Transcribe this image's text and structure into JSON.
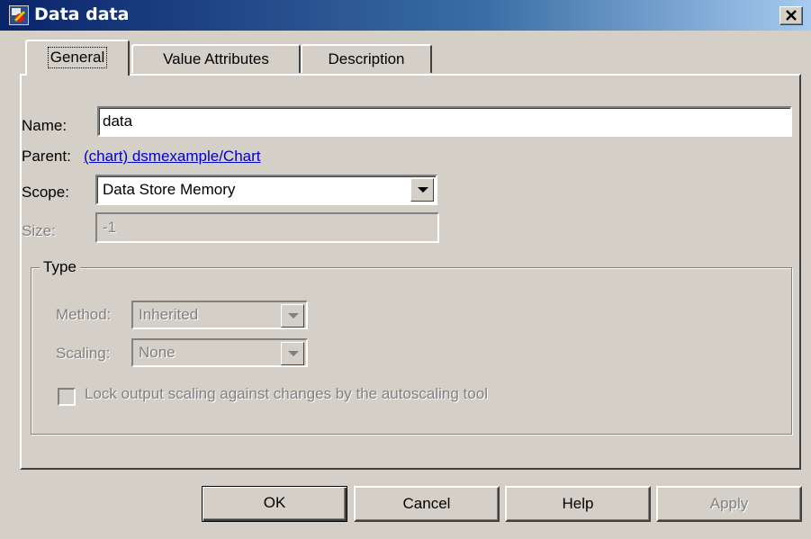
{
  "window": {
    "title": "Data data",
    "app_icon": "stateflow-app-icon",
    "close_icon": "close-icon"
  },
  "tabs": [
    {
      "label": "General",
      "selected": true
    },
    {
      "label": "Value Attributes",
      "selected": false
    },
    {
      "label": "Description",
      "selected": false
    }
  ],
  "general": {
    "name_label": "Name:",
    "name_value": "data",
    "parent_label": "Parent:",
    "parent_link": "(chart) dsmexample/Chart",
    "scope_label": "Scope:",
    "scope_value": "Data Store Memory",
    "size_label": "Size:",
    "size_value": "-1"
  },
  "type": {
    "legend": "Type",
    "method_label": "Method:",
    "method_value": "Inherited",
    "scaling_label": "Scaling:",
    "scaling_value": "None",
    "lock_label": "Lock output scaling against changes by the autoscaling tool",
    "lock_checked": false
  },
  "buttons": {
    "ok": "OK",
    "cancel": "Cancel",
    "help": "Help",
    "apply": "Apply"
  },
  "colors": {
    "titlebar_start": "#0a246a",
    "titlebar_end": "#a6caf0",
    "face": "#d4d0c8",
    "link": "#0000cc",
    "disabled": "#808080"
  }
}
